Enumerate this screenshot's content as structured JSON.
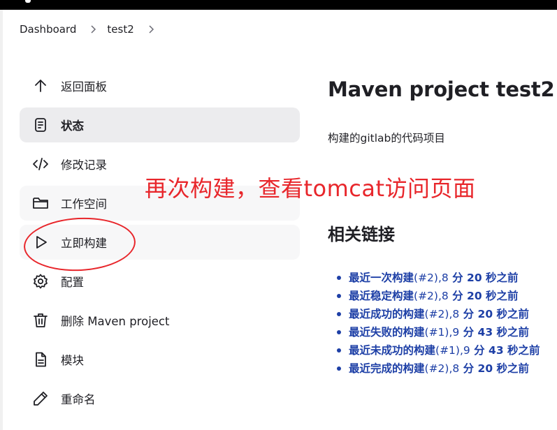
{
  "breadcrumb": {
    "items": [
      "Dashboard",
      "test2"
    ]
  },
  "sidebar": {
    "items": [
      {
        "label": "返回面板",
        "icon": "arrow-up-icon"
      },
      {
        "label": "状态",
        "icon": "document-icon"
      },
      {
        "label": "修改记录",
        "icon": "code-icon"
      },
      {
        "label": "工作空间",
        "icon": "folder-icon"
      },
      {
        "label": "立即构建",
        "icon": "play-icon"
      },
      {
        "label": "配置",
        "icon": "gear-icon"
      },
      {
        "label": "删除 Maven project",
        "icon": "trash-icon"
      },
      {
        "label": "模块",
        "icon": "file-icon"
      },
      {
        "label": "重命名",
        "icon": "pencil-icon"
      }
    ],
    "active_item": "状态"
  },
  "main": {
    "title": "Maven project test2",
    "description": "构建的gitlab的代码项目",
    "permalinks_title": "相关链接",
    "permalinks": [
      {
        "name": "最近一次构建",
        "build": "(#2),8",
        "age": " 分 20 秒之前"
      },
      {
        "name": "最近稳定构建",
        "build": "(#2),8",
        "age": " 分 20 秒之前"
      },
      {
        "name": "最近成功的构建",
        "build": "(#2),8",
        "age": " 分 20 秒之前"
      },
      {
        "name": "最近失败的构建",
        "build": "(#1),9",
        "age": " 分 43 秒之前"
      },
      {
        "name": "最近未成功的构建",
        "build": "(#1),9",
        "age": " 分 43 秒之前"
      },
      {
        "name": "最近完成的构建",
        "build": "(#2),8",
        "age": " 分 20 秒之前"
      }
    ]
  },
  "annotation": {
    "text": "再次构建，查看tomcat访问页面",
    "color": "#e8262b"
  },
  "colors": {
    "link": "#1d3fa6",
    "active_bg": "#ececee",
    "topbar": "#000000"
  }
}
